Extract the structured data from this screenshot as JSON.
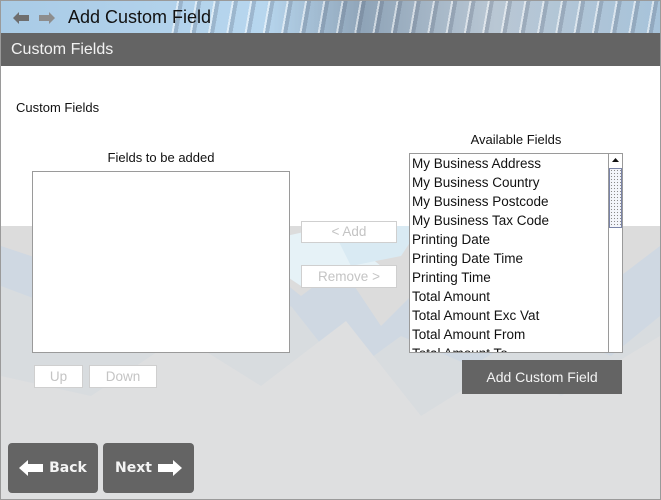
{
  "window": {
    "title": "Add Custom Field",
    "back_icon": "arrow-left-icon",
    "forward_icon": "arrow-right-icon"
  },
  "section": {
    "header": "Custom Fields",
    "sub_label": "Custom Fields"
  },
  "fields_to_add": {
    "heading": "Fields to be added",
    "items": []
  },
  "available_fields": {
    "heading": "Available Fields",
    "items": [
      "My Business Address",
      "My Business Country",
      "My Business Postcode",
      "My Business Tax Code",
      "Printing Date",
      "Printing Date Time",
      "Printing Time",
      "Total Amount",
      "Total Amount Exc Vat",
      "Total Amount From",
      "Total Amount To"
    ]
  },
  "buttons": {
    "add": "< Add",
    "remove": "Remove >",
    "up": "Up",
    "down": "Down",
    "add_custom_field": "Add Custom Field",
    "back": "Back",
    "next": "Next"
  },
  "colors": {
    "header_bg": "#646464",
    "button_dark": "#646464",
    "disabled_text": "#c4c4c4"
  }
}
